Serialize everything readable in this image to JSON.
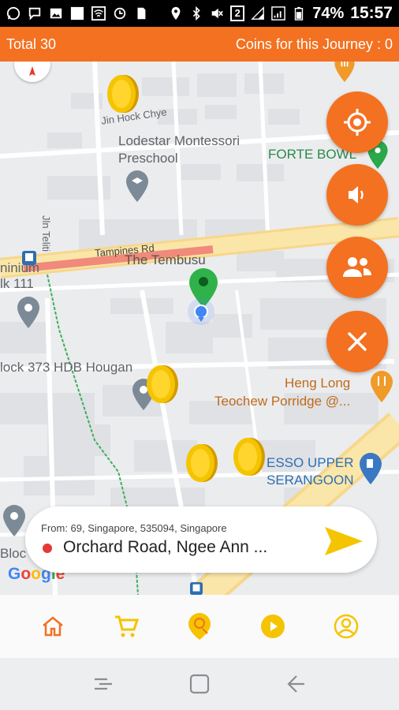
{
  "status_bar": {
    "battery_percent": "74%",
    "time": "15:57",
    "sim_badge": "2",
    "icons_left": [
      "whatsapp-icon",
      "chat-icon",
      "image-icon",
      "square-icon",
      "wifi-icon",
      "sync-icon",
      "sdcard-icon"
    ],
    "icons_right": [
      "location-icon",
      "bluetooth-icon",
      "mute-icon",
      "sim-icon",
      "signal-icon",
      "signal-icon",
      "battery-icon"
    ]
  },
  "header": {
    "total": "Total 30",
    "coins": "Coins for this Journey : 0"
  },
  "map": {
    "labels": {
      "jin_hock_chye": "Jin Hock Chye",
      "lodestar": "Lodestar Montessori\nPreschool",
      "forte_bowl": "FORTE BOWL",
      "jln_teliti": "Jln Teliti",
      "tampines_rd": "Tampines Rd",
      "the_tembusu": "The Tembusu",
      "ninium": "ninium",
      "blk111": "lk 111",
      "block373": "lock 373 HDB Hougan",
      "heng_long": "Heng Long\nTeochew Porridge @...",
      "esso": "ESSO UPPER\nSERANGOON",
      "bloc": "Bloc"
    },
    "coins_count": 4
  },
  "fabs": {
    "locate": "crosshair-icon",
    "sound": "speaker-icon",
    "group": "people-icon",
    "close": "close-icon"
  },
  "route": {
    "from": "From: 69, Singapore, 535094, Singapore",
    "to": "Orchard Road, Ngee Ann ..."
  },
  "google_logo": "Google",
  "colors": {
    "accent": "#f37121",
    "coin": "#f5c400",
    "nav_icon": "#f5c400"
  },
  "bottom_nav": [
    "home-icon",
    "cart-icon",
    "map-coin-icon",
    "play-icon",
    "account-icon"
  ],
  "system_nav": [
    "recent-apps-icon",
    "home-square-icon",
    "back-icon"
  ]
}
